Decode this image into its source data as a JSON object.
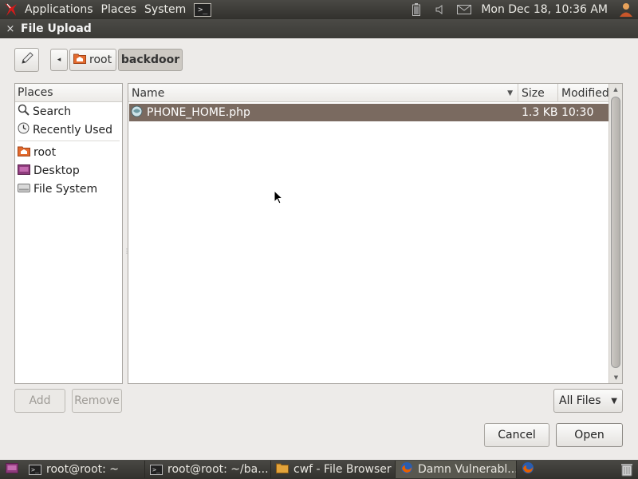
{
  "top_panel": {
    "menus": [
      "Applications",
      "Places",
      "System"
    ],
    "terminal_glyph": ">_",
    "clock": "Mon Dec 18, 10:36 AM"
  },
  "dialog": {
    "title": "File Upload",
    "close_glyph": "×",
    "back_glyph": "◂",
    "path": {
      "root": "root",
      "current": "backdoor"
    }
  },
  "places": {
    "header": "Places",
    "items": [
      "Search",
      "Recently Used",
      "root",
      "Desktop",
      "File System"
    ]
  },
  "files": {
    "columns": {
      "name": "Name",
      "size": "Size",
      "modified": "Modified"
    },
    "sort_glyph": "▼",
    "rows": [
      {
        "name": "PHONE_HOME.php",
        "size": "1.3 KB",
        "modified": "10:30"
      }
    ]
  },
  "buttons": {
    "add": "Add",
    "remove": "Remove",
    "filter": "All Files",
    "filter_glyph": "▼",
    "cancel": "Cancel",
    "open": "Open"
  },
  "taskbar": {
    "tasks": [
      "root@root: ~",
      "root@root: ~/ba...",
      "cwf - File Browser",
      "Damn Vulnerabl..."
    ]
  },
  "colors": {
    "selection": "#7a6a60",
    "panel": "#3c3b37",
    "window_bg": "#edebe9",
    "folder": "#e36a2e"
  }
}
